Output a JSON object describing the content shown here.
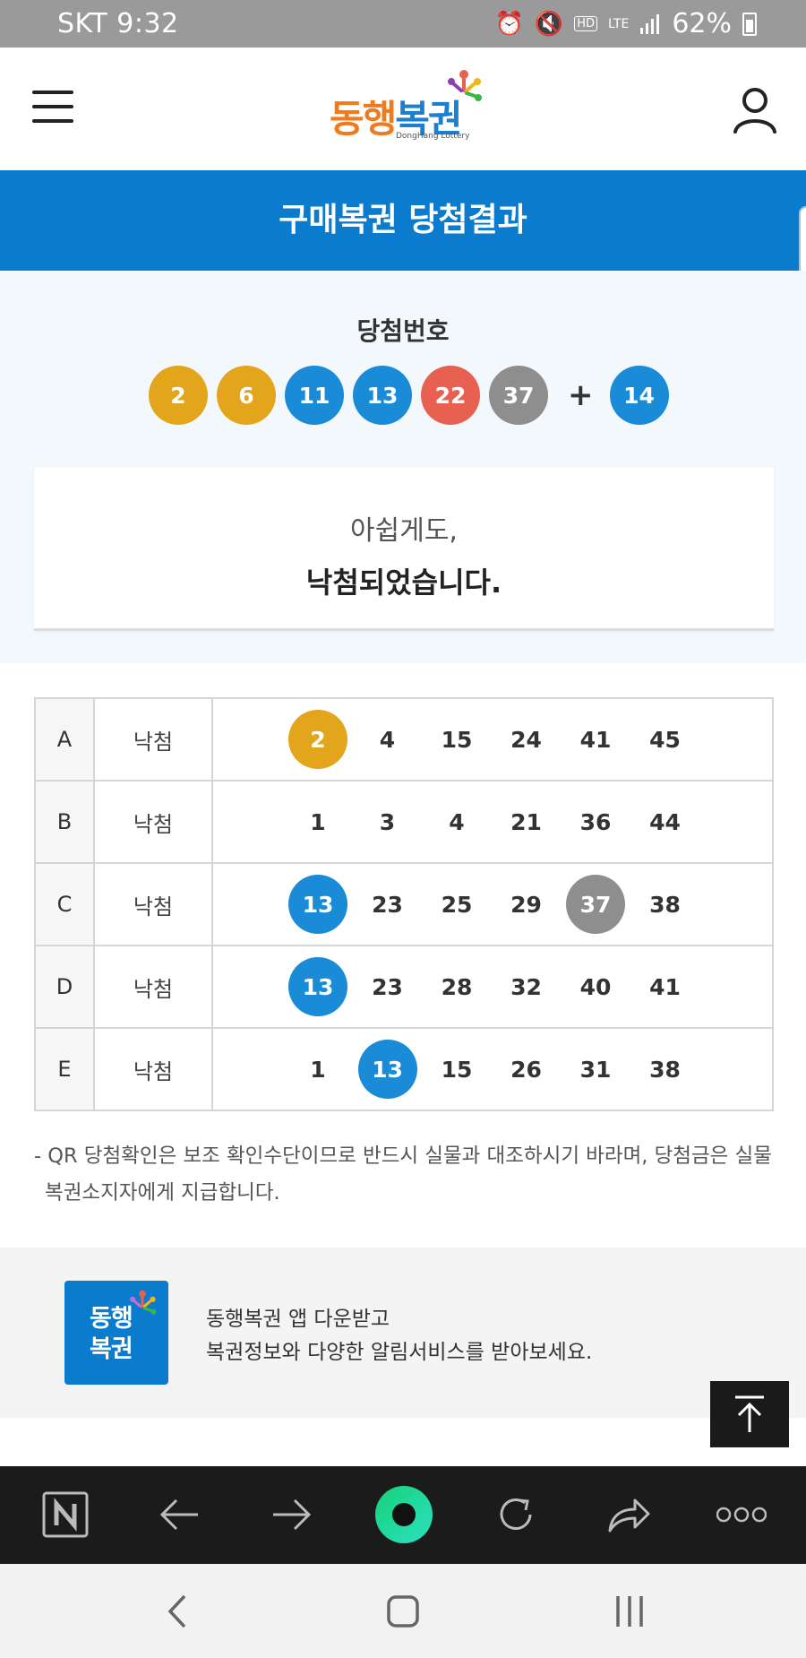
{
  "status": {
    "carrier_time": "SKT 9:32",
    "hd_label": "HD",
    "lte_label": "LTE",
    "battery": "62%"
  },
  "header": {
    "logo_ko_part1": "동행",
    "logo_ko_part2": "복권",
    "logo_en": "DongHang Lottery"
  },
  "page": {
    "title": "구매복권 당첨결과"
  },
  "winning": {
    "label": "당첨번호",
    "plus": "+",
    "balls": [
      {
        "n": "2",
        "color": "#e3a51b"
      },
      {
        "n": "6",
        "color": "#e3a51b"
      },
      {
        "n": "11",
        "color": "#1a8bd6"
      },
      {
        "n": "13",
        "color": "#1a8bd6"
      },
      {
        "n": "22",
        "color": "#e8604f"
      },
      {
        "n": "37",
        "color": "#8e8e8e"
      }
    ],
    "bonus": {
      "n": "14",
      "color": "#1a8bd6"
    }
  },
  "result": {
    "line1": "아쉽게도,",
    "line2": "낙첨되었습니다."
  },
  "games": [
    {
      "game": "A",
      "result": "낙첨",
      "numbers": [
        {
          "n": "2",
          "color": "#e3a51b"
        },
        {
          "n": "4",
          "color": ""
        },
        {
          "n": "15",
          "color": ""
        },
        {
          "n": "24",
          "color": ""
        },
        {
          "n": "41",
          "color": ""
        },
        {
          "n": "45",
          "color": ""
        }
      ]
    },
    {
      "game": "B",
      "result": "낙첨",
      "numbers": [
        {
          "n": "1",
          "color": ""
        },
        {
          "n": "3",
          "color": ""
        },
        {
          "n": "4",
          "color": ""
        },
        {
          "n": "21",
          "color": ""
        },
        {
          "n": "36",
          "color": ""
        },
        {
          "n": "44",
          "color": ""
        }
      ]
    },
    {
      "game": "C",
      "result": "낙첨",
      "numbers": [
        {
          "n": "13",
          "color": "#1a8bd6"
        },
        {
          "n": "23",
          "color": ""
        },
        {
          "n": "25",
          "color": ""
        },
        {
          "n": "29",
          "color": ""
        },
        {
          "n": "37",
          "color": "#8e8e8e"
        },
        {
          "n": "38",
          "color": ""
        }
      ]
    },
    {
      "game": "D",
      "result": "낙첨",
      "numbers": [
        {
          "n": "13",
          "color": "#1a8bd6"
        },
        {
          "n": "23",
          "color": ""
        },
        {
          "n": "28",
          "color": ""
        },
        {
          "n": "32",
          "color": ""
        },
        {
          "n": "40",
          "color": ""
        },
        {
          "n": "41",
          "color": ""
        }
      ]
    },
    {
      "game": "E",
      "result": "낙첨",
      "numbers": [
        {
          "n": "1",
          "color": ""
        },
        {
          "n": "13",
          "color": "#1a8bd6"
        },
        {
          "n": "15",
          "color": ""
        },
        {
          "n": "26",
          "color": ""
        },
        {
          "n": "31",
          "color": ""
        },
        {
          "n": "38",
          "color": ""
        }
      ]
    }
  ],
  "notice": {
    "line1": "- QR 당첨확인은 보조 확인수단이므로 반드시 실물과 대조하시기 바라며, 당첨금은 실물",
    "line2": "복권소지자에게 지급합니다."
  },
  "promo": {
    "logo_line1": "동행",
    "logo_line2": "복권",
    "line1": "동행복권 앱 다운받고",
    "line2": "복권정보와 다양한 알림서비스를 받아보세요."
  },
  "browser_bar": {
    "icons": [
      "naver-home-icon",
      "back-arrow-icon",
      "forward-arrow-icon",
      "naver-green-dot-icon",
      "reload-icon",
      "share-icon",
      "more-dots-icon"
    ]
  },
  "colors": {
    "primary_blue": "#0a7bcd",
    "yellow": "#e3a51b",
    "blue": "#1a8bd6",
    "red": "#e8604f",
    "gray": "#8e8e8e"
  }
}
